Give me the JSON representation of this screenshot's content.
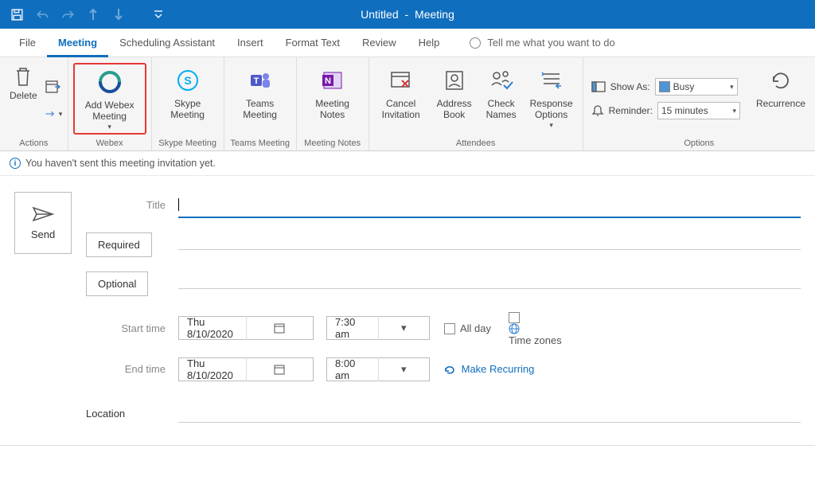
{
  "title": {
    "doc": "Untitled",
    "sep": "-",
    "context": "Meeting"
  },
  "tabs": [
    "File",
    "Meeting",
    "Scheduling Assistant",
    "Insert",
    "Format Text",
    "Review",
    "Help"
  ],
  "tellme_placeholder": "Tell me what you want to do",
  "ribbon": {
    "actions": {
      "label": "Actions",
      "delete": "Delete"
    },
    "webex": {
      "label": "Webex",
      "addwebex": "Add Webex\nMeeting"
    },
    "skype": {
      "label": "Skype Meeting",
      "skype": "Skype\nMeeting"
    },
    "teams": {
      "label": "Teams Meeting",
      "teams": "Teams\nMeeting"
    },
    "notes": {
      "label": "Meeting Notes",
      "notes": "Meeting\nNotes"
    },
    "attendees": {
      "label": "Attendees",
      "cancel": "Cancel\nInvitation",
      "book": "Address\nBook",
      "check": "Check\nNames",
      "response": "Response\nOptions"
    },
    "options": {
      "label": "Options",
      "showas_label": "Show As:",
      "showas_value": "Busy",
      "reminder_label": "Reminder:",
      "reminder_value": "15 minutes",
      "recurrence": "Recurrence"
    }
  },
  "infobar": "You haven't sent this meeting invitation yet.",
  "form": {
    "send": "Send",
    "title_label": "Title",
    "required_label": "Required",
    "optional_label": "Optional",
    "start_label": "Start time",
    "end_label": "End time",
    "start_date": "Thu 8/10/2020",
    "start_time": "7:30 am",
    "end_date": "Thu 8/10/2020",
    "end_time": "8:00 am",
    "allday": "All day",
    "timezones": "Time zones",
    "make_recurring": "Make Recurring",
    "location_label": "Location"
  }
}
